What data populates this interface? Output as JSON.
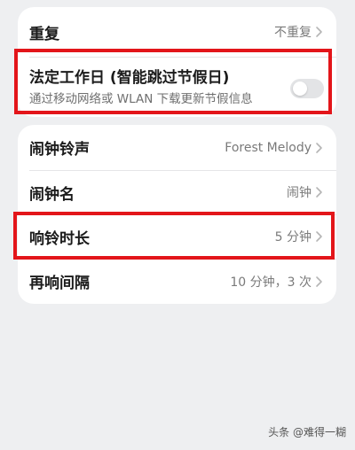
{
  "settings_card_1": {
    "repeat": {
      "label": "重复",
      "value": "不重复"
    },
    "statutory_workday": {
      "label": "法定工作日 (智能跳过节假日)",
      "description": "通过移动网络或 WLAN 下载更新节假信息",
      "enabled": false
    }
  },
  "settings_card_2": {
    "ringtone": {
      "label": "闹钟铃声",
      "value": "Forest Melody"
    },
    "alarm_name": {
      "label": "闹钟名",
      "value": "闹钟"
    },
    "ring_duration": {
      "label": "响铃时长",
      "value": "5 分钟"
    },
    "snooze_interval": {
      "label": "再响间隔",
      "value": "10 分钟，3 次"
    }
  },
  "colors": {
    "highlight": "#e3151a",
    "background": "#eeeff1"
  },
  "watermark": "头条 @难得一糊"
}
